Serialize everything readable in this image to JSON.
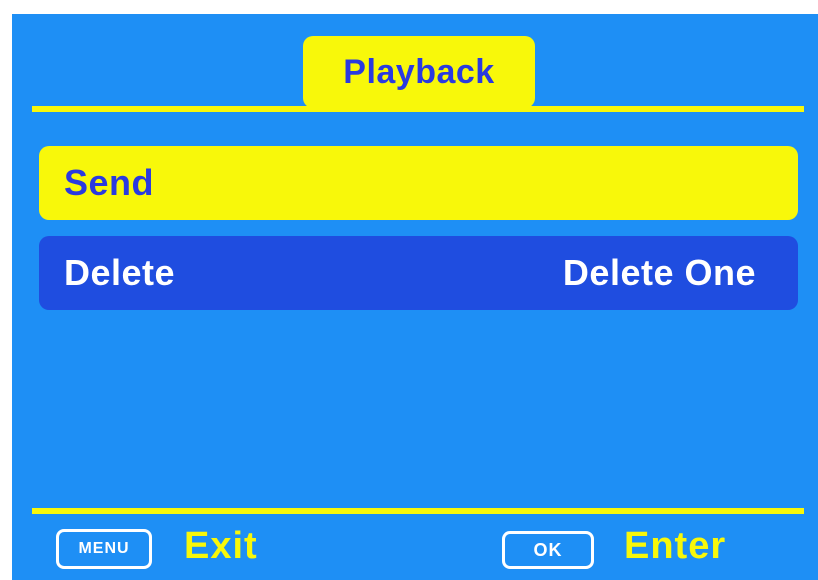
{
  "header": {
    "title": "Playback"
  },
  "menu": {
    "items": [
      {
        "label": "Send",
        "value": "",
        "selected": true
      },
      {
        "label": "Delete",
        "value": "Delete One",
        "selected": false
      }
    ]
  },
  "footer": {
    "menu_key": "MENU",
    "menu_action": "Exit",
    "ok_key": "OK",
    "ok_action": "Enter"
  },
  "colors": {
    "background": "#1e8ff5",
    "accent": "#f8f80a",
    "selected_text": "#2a3ae0",
    "row_background": "#1f4de0"
  }
}
